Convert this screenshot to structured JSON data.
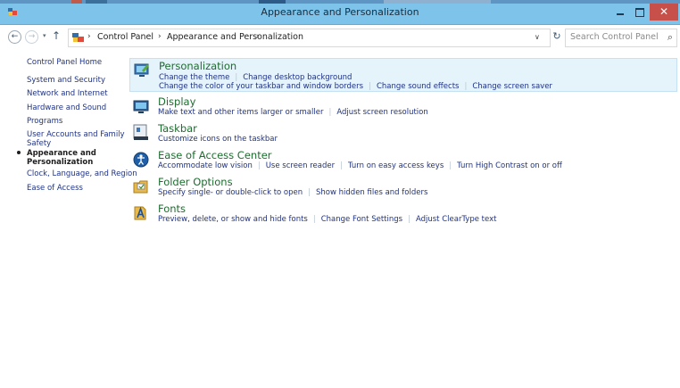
{
  "window": {
    "title": "Appearance and Personalization",
    "close_glyph": "✕",
    "accent": "#7ec4ea",
    "close_color": "#c7504a"
  },
  "nav": {
    "back_glyph": "←",
    "forward_glyph": "→",
    "dropdown_glyph": "▾",
    "up_glyph": "↑",
    "breadcrumbs": [
      "Control Panel",
      "Appearance and Personalization"
    ],
    "crumb_separator": "›",
    "address_dropdown_glyph": "∨",
    "refresh_glyph": "↻",
    "search_placeholder": "Search Control Panel",
    "search_glyph": "⌕"
  },
  "sidebar": {
    "items": [
      {
        "label": "Control Panel Home"
      },
      {
        "label": "System and Security"
      },
      {
        "label": "Network and Internet"
      },
      {
        "label": "Hardware and Sound"
      },
      {
        "label": "Programs"
      },
      {
        "label": "User Accounts and Family",
        "label2": "Safety"
      },
      {
        "label": "Appearance and",
        "label2": "Personalization",
        "current": true
      },
      {
        "label": "Clock, Language, and Region"
      },
      {
        "label": "Ease of Access"
      }
    ]
  },
  "categories": [
    {
      "title": "Personalization",
      "icon": "personalization-icon",
      "selected": true,
      "link_rows": [
        [
          "Change the theme",
          "Change desktop background"
        ],
        [
          "Change the color of your taskbar and window borders",
          "Change sound effects",
          "Change screen saver"
        ]
      ]
    },
    {
      "title": "Display",
      "icon": "display-icon",
      "link_rows": [
        [
          "Make text and other items larger or smaller",
          "Adjust screen resolution"
        ]
      ]
    },
    {
      "title": "Taskbar",
      "icon": "taskbar-icon",
      "link_rows": [
        [
          "Customize icons on the taskbar"
        ]
      ]
    },
    {
      "title": "Ease of Access Center",
      "icon": "ease-of-access-icon",
      "link_rows": [
        [
          "Accommodate low vision",
          "Use screen reader",
          "Turn on easy access keys",
          "Turn High Contrast on or off"
        ]
      ]
    },
    {
      "title": "Folder Options",
      "icon": "folder-options-icon",
      "link_rows": [
        [
          "Specify single- or double-click to open",
          "Show hidden files and folders"
        ]
      ]
    },
    {
      "title": "Fonts",
      "icon": "fonts-icon",
      "link_rows": [
        [
          "Preview, delete, or show and hide fonts",
          "Change Font Settings",
          "Adjust ClearType text"
        ]
      ]
    }
  ]
}
